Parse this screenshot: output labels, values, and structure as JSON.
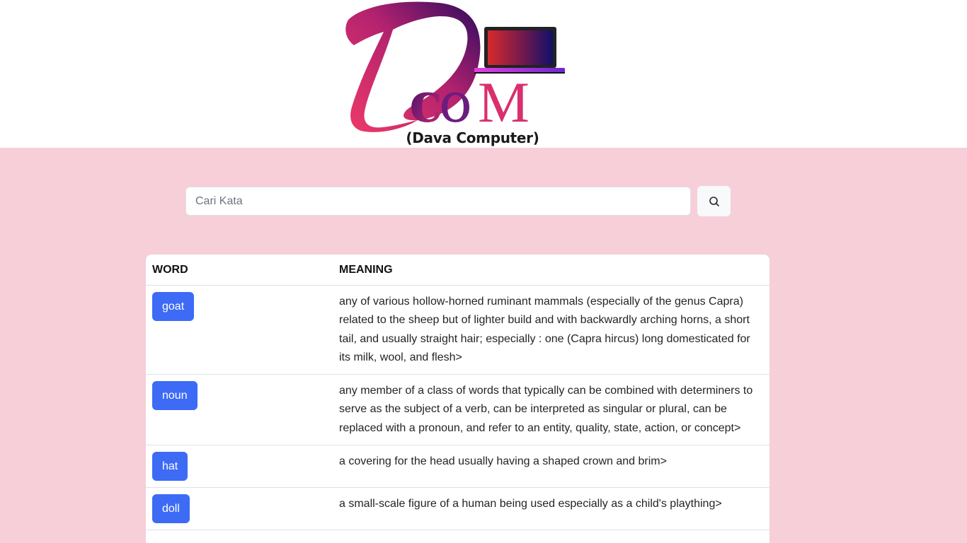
{
  "header": {
    "logo_caption": "(Dava Computer)",
    "logo_icon": "dcom-logo-icon"
  },
  "search": {
    "placeholder": "Cari Kata",
    "value": "",
    "button_icon": "search-icon"
  },
  "table": {
    "headers": {
      "word": "WORD",
      "meaning": "MEANING"
    },
    "rows": [
      {
        "word": "goat",
        "meaning": "any of various hollow-horned ruminant mammals (especially of the genus Capra) related to the sheep but of lighter build and with backwardly arching horns, a short tail, and usually straight hair; especially : one (Capra hircus) long domesticated for its milk, wool, and flesh>"
      },
      {
        "word": "noun",
        "meaning": "any member of a class of words that typically can be combined with determiners to serve as the subject of a verb, can be interpreted as singular or plural, can be replaced with a pronoun, and refer to an entity, quality, state, action, or concept>"
      },
      {
        "word": "hat",
        "meaning": "a covering for the head usually having a shaped crown and brim>"
      },
      {
        "word": "doll",
        "meaning": "a small-scale figure of a human being used especially as a child's plaything>"
      }
    ]
  },
  "colors": {
    "page_background": "#f6cfd9",
    "word_button": "#3d6bf6",
    "logo_pink": "#e0306a",
    "logo_purple": "#5b1a8a"
  }
}
